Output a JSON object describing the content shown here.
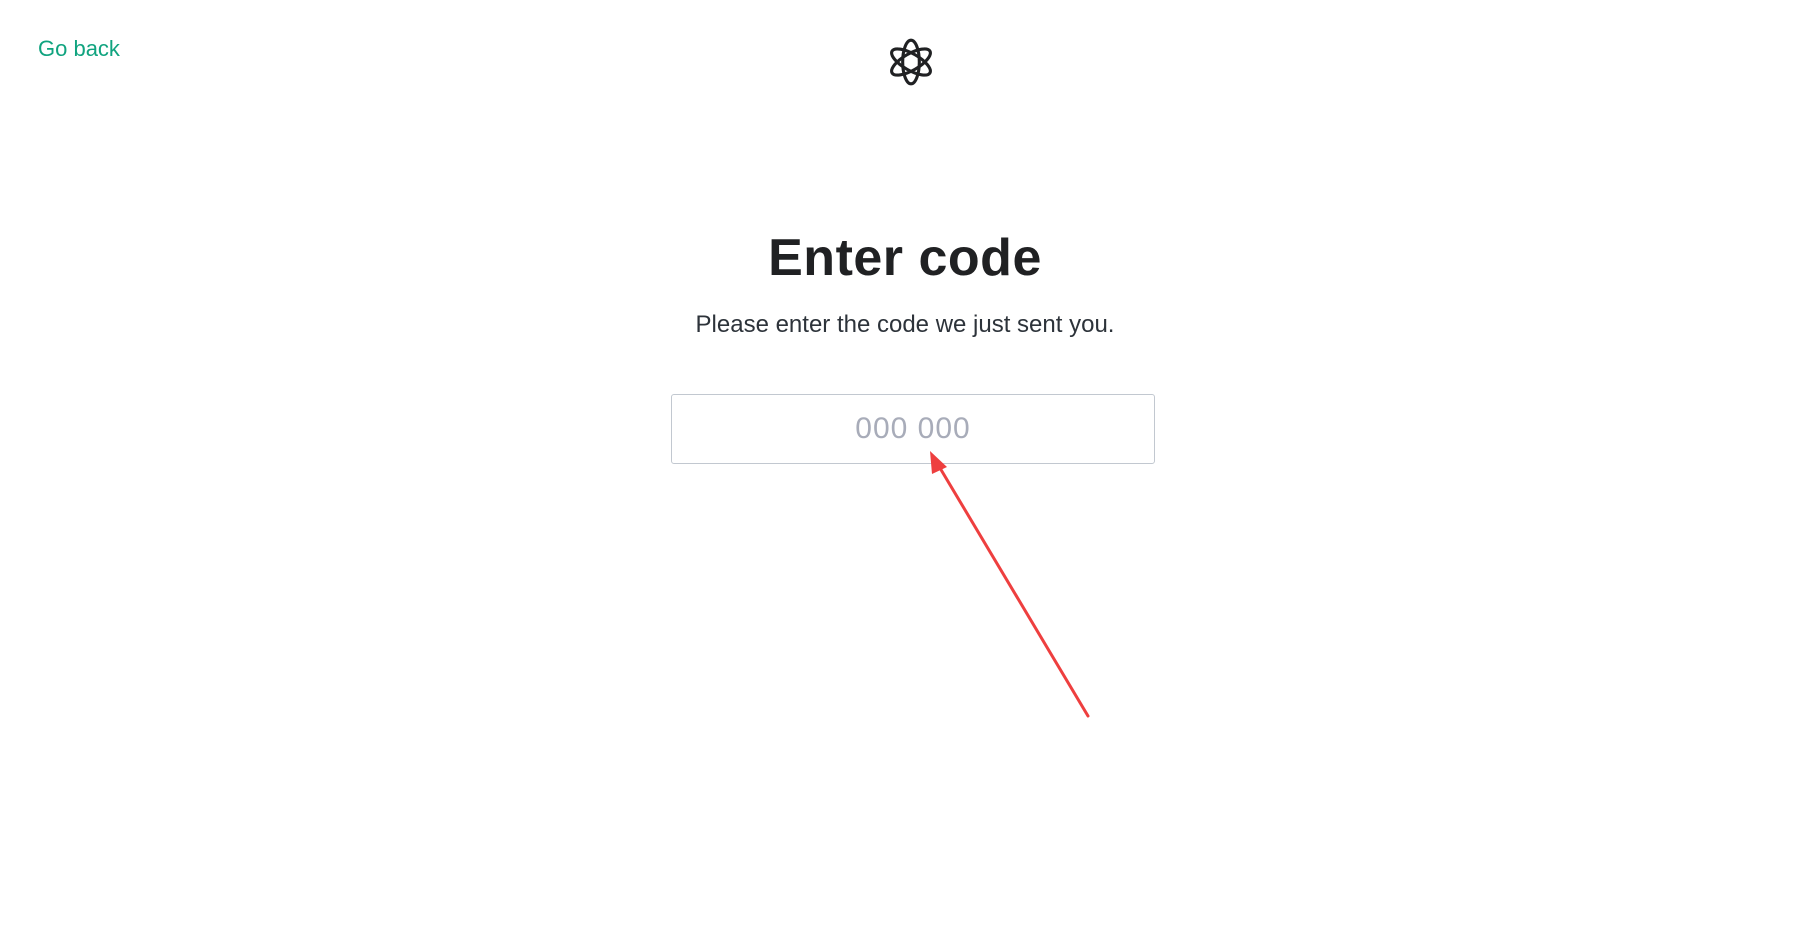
{
  "nav": {
    "go_back_label": "Go back"
  },
  "brand": {
    "logo_icon": "openai-logo-icon"
  },
  "main": {
    "title": "Enter code",
    "subtitle": "Please enter the code we just sent you.",
    "code_input": {
      "value": "",
      "placeholder": "000 000"
    }
  },
  "annotation": {
    "arrow_icon": "red-arrow-annotation",
    "arrow_color": "#ee3f3f"
  },
  "colors": {
    "accent": "#10a37f",
    "text": "#202123",
    "border": "#c2c8d0",
    "placeholder": "#a8acb9"
  }
}
